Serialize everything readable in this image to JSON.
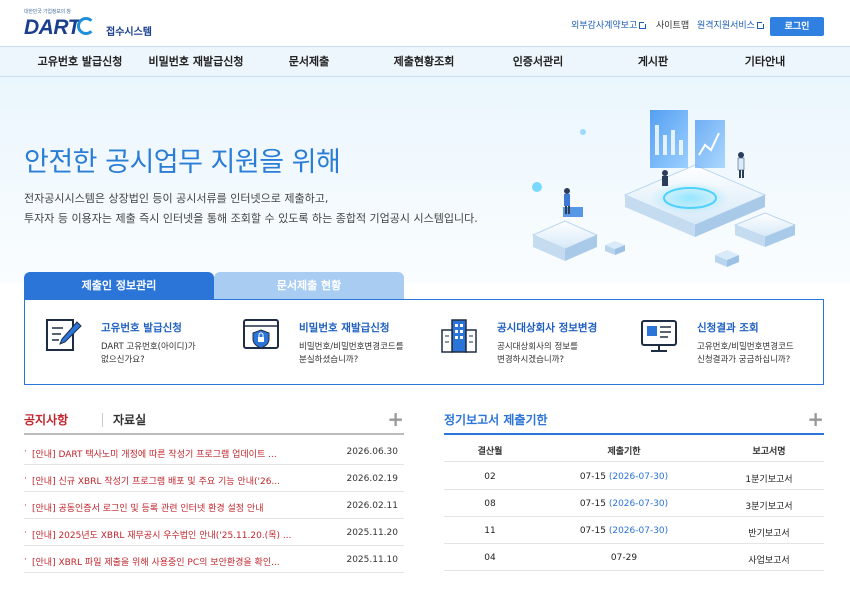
{
  "header": {
    "logo_tagline": "대한민국 기업정보의 창",
    "logo_text": "DART",
    "logo_subtitle": "접수시스템",
    "util_links": [
      "외부감사계약보고",
      "사이트맵",
      "원격지원서비스"
    ],
    "login_label": "로그인"
  },
  "nav": {
    "items": [
      "고유번호 발급신청",
      "비밀번호 재발급신청",
      "문서제출",
      "제출현황조회",
      "인증서관리",
      "게시판",
      "기타안내"
    ]
  },
  "hero": {
    "title": "안전한 공시업무 지원을 위해",
    "desc_line1": "전자공시시스템은 상장법인 등이 공시서류를 인터넷으로 제출하고,",
    "desc_line2": "투자자 등 이용자는 제출 즉시 인터넷을 통해 조회할 수 있도록 하는 종합적 기업공시 시스템입니다."
  },
  "tabs": {
    "active": "제출인 정보관리",
    "inactive": "문서제출 현황"
  },
  "services": [
    {
      "title": "고유번호 발급신청",
      "desc": "DART 고유번호(아이디)가 없으신가요?",
      "icon": "edit-document-icon"
    },
    {
      "title": "비밀번호 재발급신청",
      "desc": "비밀번호/비밀번호변경코드를 분실하셨습니까?",
      "icon": "lock-screen-icon"
    },
    {
      "title": "공시대상회사 정보변경",
      "desc": "공시대상회사의 정보를 변경하시겠습니까?",
      "icon": "building-icon"
    },
    {
      "title": "신청결과 조회",
      "desc": "고유번호/비밀번호변경코드 신청결과가 궁금하십니까?",
      "icon": "monitor-result-icon"
    }
  ],
  "notices": {
    "tab_notice": "공지사항",
    "tab_archive": "자료실",
    "more": "+",
    "items": [
      {
        "title": "[안내] DART 택사노미 개정에 따른 작성기 프로그램 업데이트 ...",
        "date": "2026.06.30"
      },
      {
        "title": "[안내] 신규 XBRL 작성기 프로그램 배포 및 주요 기능 안내('26...",
        "date": "2026.02.19"
      },
      {
        "title": "[안내] 공동인증서 로그인 및 등록 관련 인터넷 환경 설정 안내",
        "date": "2026.02.11"
      },
      {
        "title": "[안내] 2025년도 XBRL 재무공시 우수법인 안내('25.11.20.(목) ...",
        "date": "2025.11.20"
      },
      {
        "title": "[안내] XBRL 파일 제출을 위해 사용중인 PC의 보안환경을 확인...",
        "date": "2025.11.10"
      }
    ]
  },
  "deadlines": {
    "title": "정기보고서 제출기한",
    "more": "+",
    "headers": [
      "결산월",
      "제출기한",
      "보고서명"
    ],
    "rows": [
      {
        "month": "02",
        "due": "07-15",
        "due_ext": "(2026-07-30)",
        "report": "1분기보고서"
      },
      {
        "month": "08",
        "due": "07-15",
        "due_ext": "(2026-07-30)",
        "report": "3분기보고서"
      },
      {
        "month": "11",
        "due": "07-15",
        "due_ext": "(2026-07-30)",
        "report": "반기보고서"
      },
      {
        "month": "04",
        "due": "07-29",
        "due_ext": "",
        "report": "사업보고서"
      }
    ]
  },
  "colors": {
    "primary": "#2b74d8",
    "nav_bg": "#eef6fd",
    "notice_red": "#c0262d",
    "hero_title": "#2a7dd6"
  }
}
